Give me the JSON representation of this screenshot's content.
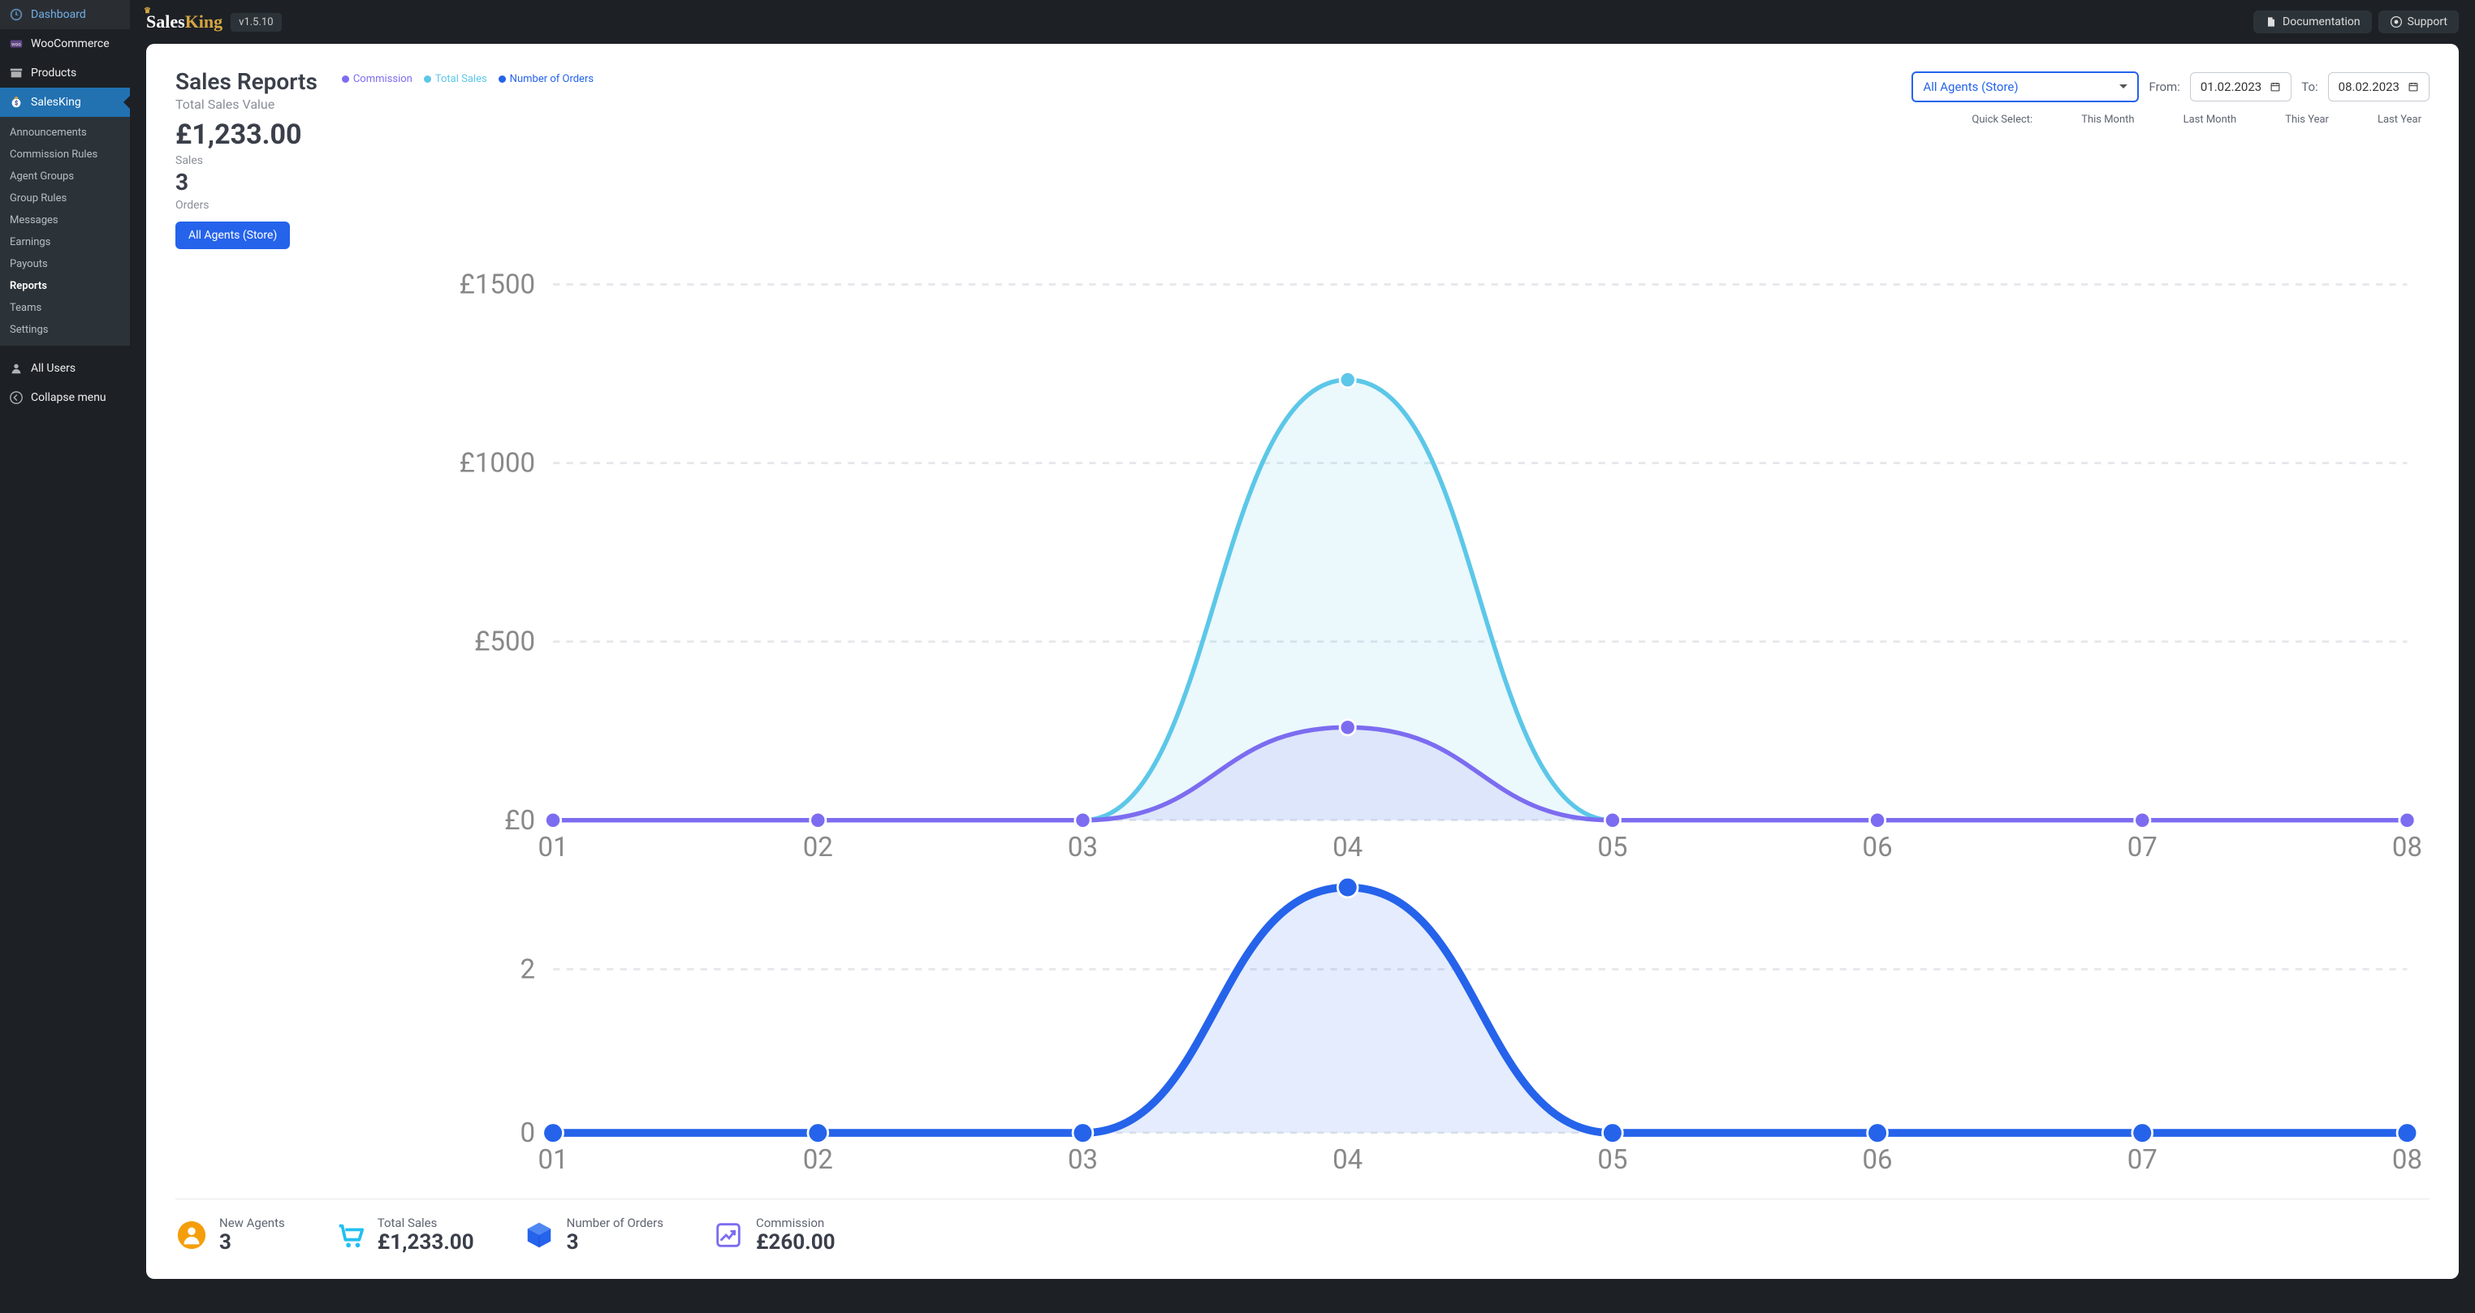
{
  "brand": {
    "name_a": "Sales",
    "name_b": "King",
    "version": "v1.5.10"
  },
  "topbar": {
    "docs": "Documentation",
    "support": "Support"
  },
  "sidebar": {
    "items": [
      {
        "label": "Dashboard"
      },
      {
        "label": "WooCommerce"
      },
      {
        "label": "Products"
      },
      {
        "label": "SalesKing"
      },
      {
        "label": "All Users"
      },
      {
        "label": "Collapse menu"
      }
    ],
    "submenu": [
      {
        "label": "Announcements"
      },
      {
        "label": "Commission Rules"
      },
      {
        "label": "Agent Groups"
      },
      {
        "label": "Group Rules"
      },
      {
        "label": "Messages"
      },
      {
        "label": "Earnings"
      },
      {
        "label": "Payouts"
      },
      {
        "label": "Reports"
      },
      {
        "label": "Teams"
      },
      {
        "label": "Settings"
      }
    ]
  },
  "page": {
    "title": "Sales Reports",
    "subtitle": "Total Sales Value",
    "total_value": "£1,233.00",
    "sales_label": "Sales",
    "orders_count": "3",
    "orders_label": "Orders",
    "filter_button": "All Agents (Store)"
  },
  "legend": {
    "commission": {
      "label": "Commission",
      "color": "#7c6cf0"
    },
    "total_sales": {
      "label": "Total Sales",
      "color": "#5cc7e8"
    },
    "num_orders": {
      "label": "Number of Orders",
      "color": "#2563eb"
    }
  },
  "controls": {
    "agent_select": "All Agents (Store)",
    "from_label": "From:",
    "from_value": "01.02.2023",
    "to_label": "To:",
    "to_value": "08.02.2023"
  },
  "quick_select": {
    "label": "Quick Select:",
    "items": [
      "This Month",
      "Last Month",
      "This Year",
      "Last Year"
    ]
  },
  "stats": [
    {
      "label": "New Agents",
      "value": "3",
      "color": "#f59e0b",
      "icon": "user"
    },
    {
      "label": "Total Sales",
      "value": "£1,233.00",
      "color": "#22c0f0",
      "icon": "cart"
    },
    {
      "label": "Number of Orders",
      "value": "3",
      "color": "#2563eb",
      "icon": "box"
    },
    {
      "label": "Commission",
      "value": "£260.00",
      "color": "#7c6cf0",
      "icon": "growth"
    }
  ],
  "chart_data": [
    {
      "type": "line",
      "x": [
        "01",
        "02",
        "03",
        "04",
        "05",
        "06",
        "07",
        "08"
      ],
      "ylabel": "",
      "ylim": [
        0,
        1500
      ],
      "yticks": [
        "£0",
        "£500",
        "£1000",
        "£1500"
      ],
      "series": [
        {
          "name": "Total Sales",
          "color": "#5cc7e8",
          "values": [
            0,
            0,
            0,
            1233,
            0,
            0,
            0,
            0
          ]
        },
        {
          "name": "Commission",
          "color": "#7c6cf0",
          "values": [
            0,
            0,
            0,
            260,
            0,
            0,
            0,
            0
          ]
        }
      ]
    },
    {
      "type": "line",
      "x": [
        "01",
        "02",
        "03",
        "04",
        "05",
        "06",
        "07",
        "08"
      ],
      "ylabel": "",
      "ylim": [
        0,
        3
      ],
      "yticks": [
        "0",
        "2"
      ],
      "series": [
        {
          "name": "Number of Orders",
          "color": "#2563eb",
          "values": [
            0,
            0,
            0,
            3,
            0,
            0,
            0,
            0
          ]
        }
      ]
    }
  ]
}
